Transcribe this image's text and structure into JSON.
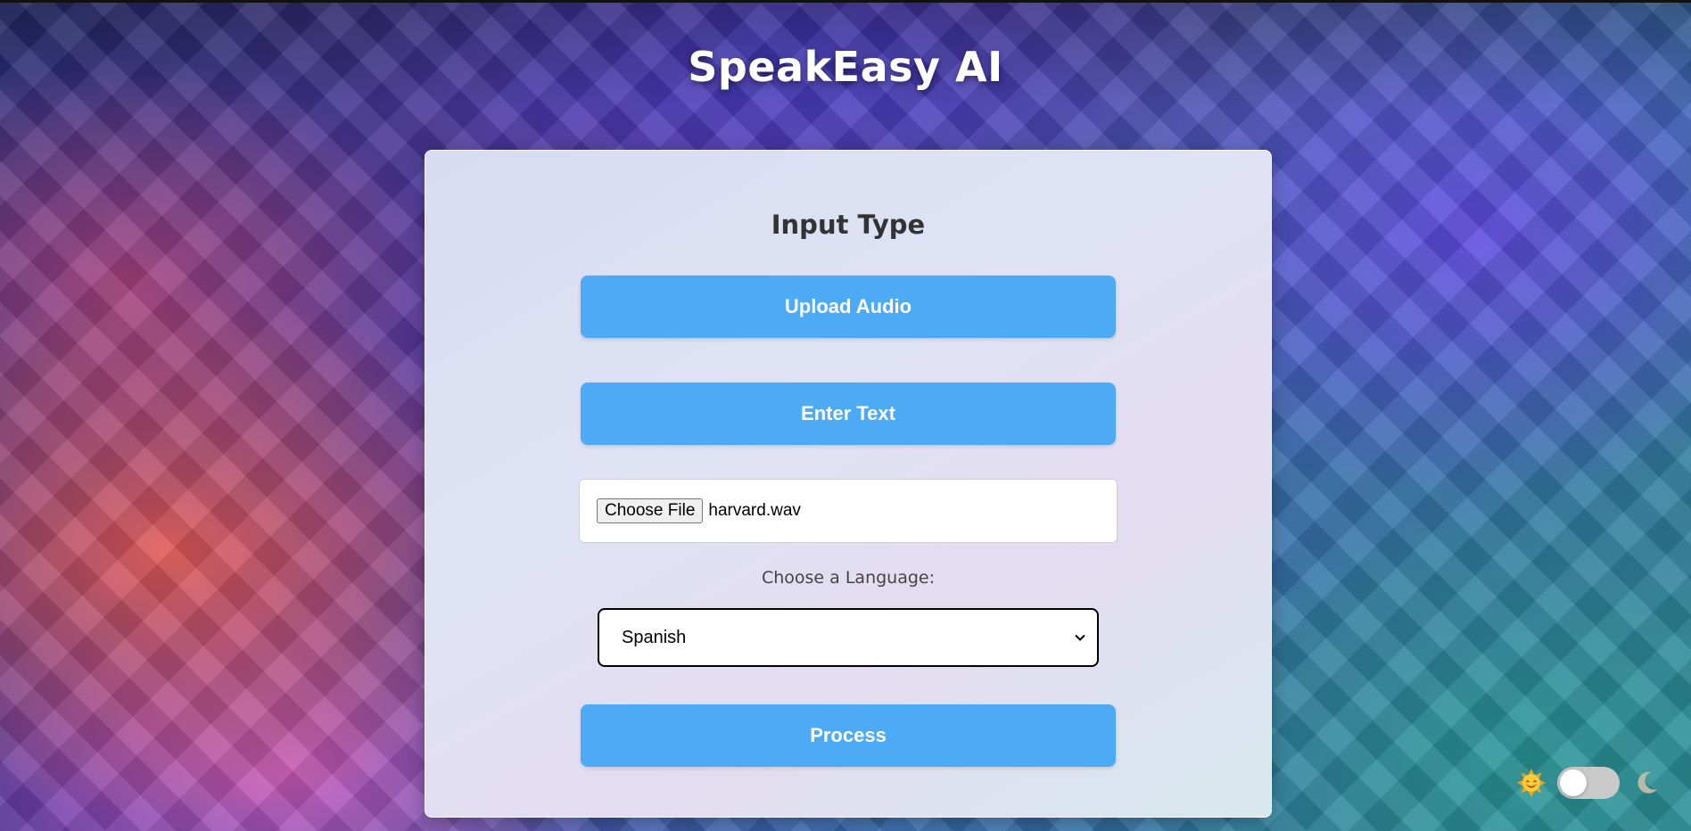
{
  "app": {
    "title": "SpeakEasy AI"
  },
  "form": {
    "section_title": "Input Type",
    "upload_audio_label": "Upload Audio",
    "enter_text_label": "Enter Text",
    "file_input": {
      "button_label": "Choose File",
      "file_name": "harvard.wav"
    },
    "language_label": "Choose a Language:",
    "language_selected": "Spanish",
    "process_label": "Process"
  },
  "theme_toggle": {
    "state": "light",
    "left_icon": "sun-face-icon",
    "right_icon": "crescent-moon-icon"
  },
  "colors": {
    "button": "#4dabf5",
    "button_text": "#ffffff",
    "card_background": "#dfe3f4"
  }
}
